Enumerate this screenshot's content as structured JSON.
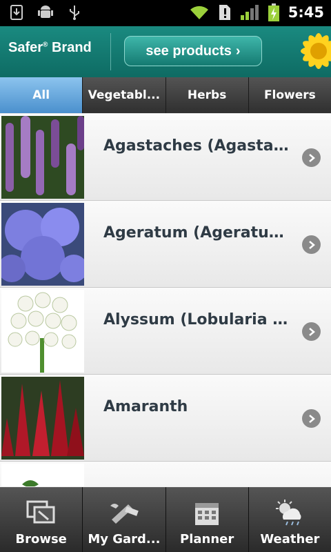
{
  "status": {
    "time": "5:45"
  },
  "banner": {
    "brand": "Safer",
    "brand_suffix": "Brand",
    "button_label": "see products"
  },
  "tabs": [
    {
      "label": "All"
    },
    {
      "label": "Vegetabl..."
    },
    {
      "label": "Herbs"
    },
    {
      "label": "Flowers"
    }
  ],
  "plants": [
    {
      "name": "Agastaches (Agastache...)"
    },
    {
      "name": "Ageratum (Ageratum ...)"
    },
    {
      "name": "Alyssum (Lobularia m...)"
    },
    {
      "name": "Amaranth"
    }
  ],
  "bottom_nav": [
    {
      "label": "Browse",
      "icon": "browse-icon"
    },
    {
      "label": "My Gard...",
      "icon": "garden-tools-icon"
    },
    {
      "label": "Planner",
      "icon": "calendar-icon"
    },
    {
      "label": "Weather",
      "icon": "weather-icon"
    }
  ],
  "colors": {
    "accent": "#4a90cd",
    "banner": "#0e6b63"
  }
}
